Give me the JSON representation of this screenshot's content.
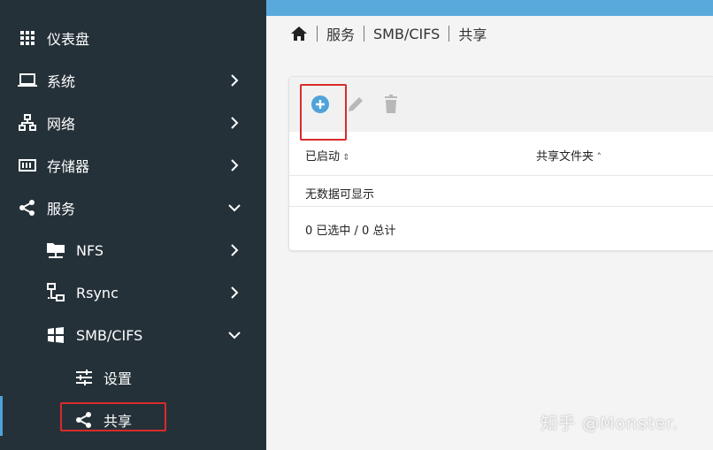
{
  "sidebar": {
    "items": [
      {
        "label": "仪表盘"
      },
      {
        "label": "系统"
      },
      {
        "label": "网络"
      },
      {
        "label": "存储器"
      },
      {
        "label": "服务"
      },
      {
        "label": "NFS"
      },
      {
        "label": "Rsync"
      },
      {
        "label": "SMB/CIFS"
      },
      {
        "label": "设置"
      },
      {
        "label": "共享"
      }
    ]
  },
  "breadcrumb": [
    "服务",
    "SMB/CIFS",
    "共享"
  ],
  "table": {
    "columns": [
      "已启动",
      "共享文件夹"
    ],
    "empty_text": "无数据可显示",
    "footer": "0 已选中 / 0 总计"
  },
  "colors": {
    "accent": "#4fa3d9",
    "highlight": "#d92b2b",
    "sidebar_bg": "#253139"
  },
  "watermark": "知乎 @Monster."
}
